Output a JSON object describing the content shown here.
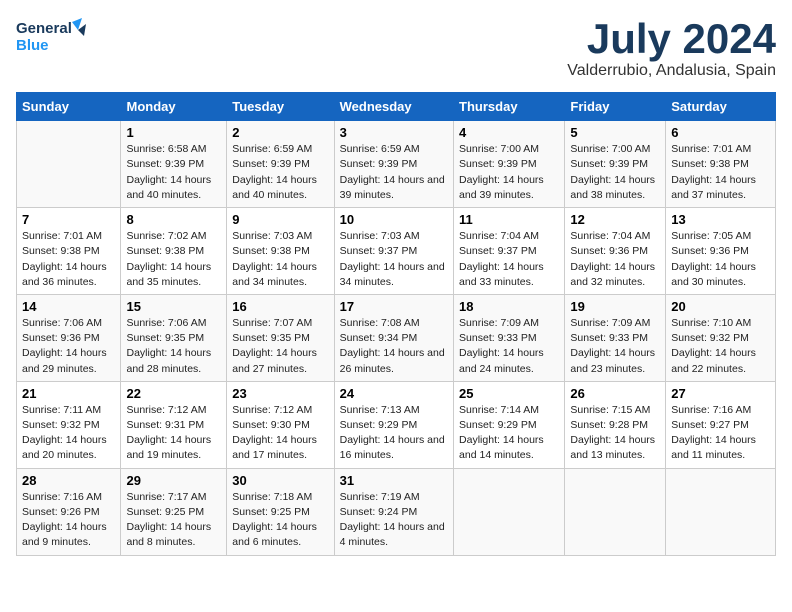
{
  "logo": {
    "line1": "General",
    "line2": "Blue"
  },
  "title": "July 2024",
  "subtitle": "Valderrubio, Andalusia, Spain",
  "columns": [
    "Sunday",
    "Monday",
    "Tuesday",
    "Wednesday",
    "Thursday",
    "Friday",
    "Saturday"
  ],
  "weeks": [
    [
      {
        "day": "",
        "sunrise": "",
        "sunset": "",
        "daylight": ""
      },
      {
        "day": "1",
        "sunrise": "Sunrise: 6:58 AM",
        "sunset": "Sunset: 9:39 PM",
        "daylight": "Daylight: 14 hours and 40 minutes."
      },
      {
        "day": "2",
        "sunrise": "Sunrise: 6:59 AM",
        "sunset": "Sunset: 9:39 PM",
        "daylight": "Daylight: 14 hours and 40 minutes."
      },
      {
        "day": "3",
        "sunrise": "Sunrise: 6:59 AM",
        "sunset": "Sunset: 9:39 PM",
        "daylight": "Daylight: 14 hours and 39 minutes."
      },
      {
        "day": "4",
        "sunrise": "Sunrise: 7:00 AM",
        "sunset": "Sunset: 9:39 PM",
        "daylight": "Daylight: 14 hours and 39 minutes."
      },
      {
        "day": "5",
        "sunrise": "Sunrise: 7:00 AM",
        "sunset": "Sunset: 9:39 PM",
        "daylight": "Daylight: 14 hours and 38 minutes."
      },
      {
        "day": "6",
        "sunrise": "Sunrise: 7:01 AM",
        "sunset": "Sunset: 9:38 PM",
        "daylight": "Daylight: 14 hours and 37 minutes."
      }
    ],
    [
      {
        "day": "7",
        "sunrise": "Sunrise: 7:01 AM",
        "sunset": "Sunset: 9:38 PM",
        "daylight": "Daylight: 14 hours and 36 minutes."
      },
      {
        "day": "8",
        "sunrise": "Sunrise: 7:02 AM",
        "sunset": "Sunset: 9:38 PM",
        "daylight": "Daylight: 14 hours and 35 minutes."
      },
      {
        "day": "9",
        "sunrise": "Sunrise: 7:03 AM",
        "sunset": "Sunset: 9:38 PM",
        "daylight": "Daylight: 14 hours and 34 minutes."
      },
      {
        "day": "10",
        "sunrise": "Sunrise: 7:03 AM",
        "sunset": "Sunset: 9:37 PM",
        "daylight": "Daylight: 14 hours and 34 minutes."
      },
      {
        "day": "11",
        "sunrise": "Sunrise: 7:04 AM",
        "sunset": "Sunset: 9:37 PM",
        "daylight": "Daylight: 14 hours and 33 minutes."
      },
      {
        "day": "12",
        "sunrise": "Sunrise: 7:04 AM",
        "sunset": "Sunset: 9:36 PM",
        "daylight": "Daylight: 14 hours and 32 minutes."
      },
      {
        "day": "13",
        "sunrise": "Sunrise: 7:05 AM",
        "sunset": "Sunset: 9:36 PM",
        "daylight": "Daylight: 14 hours and 30 minutes."
      }
    ],
    [
      {
        "day": "14",
        "sunrise": "Sunrise: 7:06 AM",
        "sunset": "Sunset: 9:36 PM",
        "daylight": "Daylight: 14 hours and 29 minutes."
      },
      {
        "day": "15",
        "sunrise": "Sunrise: 7:06 AM",
        "sunset": "Sunset: 9:35 PM",
        "daylight": "Daylight: 14 hours and 28 minutes."
      },
      {
        "day": "16",
        "sunrise": "Sunrise: 7:07 AM",
        "sunset": "Sunset: 9:35 PM",
        "daylight": "Daylight: 14 hours and 27 minutes."
      },
      {
        "day": "17",
        "sunrise": "Sunrise: 7:08 AM",
        "sunset": "Sunset: 9:34 PM",
        "daylight": "Daylight: 14 hours and 26 minutes."
      },
      {
        "day": "18",
        "sunrise": "Sunrise: 7:09 AM",
        "sunset": "Sunset: 9:33 PM",
        "daylight": "Daylight: 14 hours and 24 minutes."
      },
      {
        "day": "19",
        "sunrise": "Sunrise: 7:09 AM",
        "sunset": "Sunset: 9:33 PM",
        "daylight": "Daylight: 14 hours and 23 minutes."
      },
      {
        "day": "20",
        "sunrise": "Sunrise: 7:10 AM",
        "sunset": "Sunset: 9:32 PM",
        "daylight": "Daylight: 14 hours and 22 minutes."
      }
    ],
    [
      {
        "day": "21",
        "sunrise": "Sunrise: 7:11 AM",
        "sunset": "Sunset: 9:32 PM",
        "daylight": "Daylight: 14 hours and 20 minutes."
      },
      {
        "day": "22",
        "sunrise": "Sunrise: 7:12 AM",
        "sunset": "Sunset: 9:31 PM",
        "daylight": "Daylight: 14 hours and 19 minutes."
      },
      {
        "day": "23",
        "sunrise": "Sunrise: 7:12 AM",
        "sunset": "Sunset: 9:30 PM",
        "daylight": "Daylight: 14 hours and 17 minutes."
      },
      {
        "day": "24",
        "sunrise": "Sunrise: 7:13 AM",
        "sunset": "Sunset: 9:29 PM",
        "daylight": "Daylight: 14 hours and 16 minutes."
      },
      {
        "day": "25",
        "sunrise": "Sunrise: 7:14 AM",
        "sunset": "Sunset: 9:29 PM",
        "daylight": "Daylight: 14 hours and 14 minutes."
      },
      {
        "day": "26",
        "sunrise": "Sunrise: 7:15 AM",
        "sunset": "Sunset: 9:28 PM",
        "daylight": "Daylight: 14 hours and 13 minutes."
      },
      {
        "day": "27",
        "sunrise": "Sunrise: 7:16 AM",
        "sunset": "Sunset: 9:27 PM",
        "daylight": "Daylight: 14 hours and 11 minutes."
      }
    ],
    [
      {
        "day": "28",
        "sunrise": "Sunrise: 7:16 AM",
        "sunset": "Sunset: 9:26 PM",
        "daylight": "Daylight: 14 hours and 9 minutes."
      },
      {
        "day": "29",
        "sunrise": "Sunrise: 7:17 AM",
        "sunset": "Sunset: 9:25 PM",
        "daylight": "Daylight: 14 hours and 8 minutes."
      },
      {
        "day": "30",
        "sunrise": "Sunrise: 7:18 AM",
        "sunset": "Sunset: 9:25 PM",
        "daylight": "Daylight: 14 hours and 6 minutes."
      },
      {
        "day": "31",
        "sunrise": "Sunrise: 7:19 AM",
        "sunset": "Sunset: 9:24 PM",
        "daylight": "Daylight: 14 hours and 4 minutes."
      },
      {
        "day": "",
        "sunrise": "",
        "sunset": "",
        "daylight": ""
      },
      {
        "day": "",
        "sunrise": "",
        "sunset": "",
        "daylight": ""
      },
      {
        "day": "",
        "sunrise": "",
        "sunset": "",
        "daylight": ""
      }
    ]
  ]
}
